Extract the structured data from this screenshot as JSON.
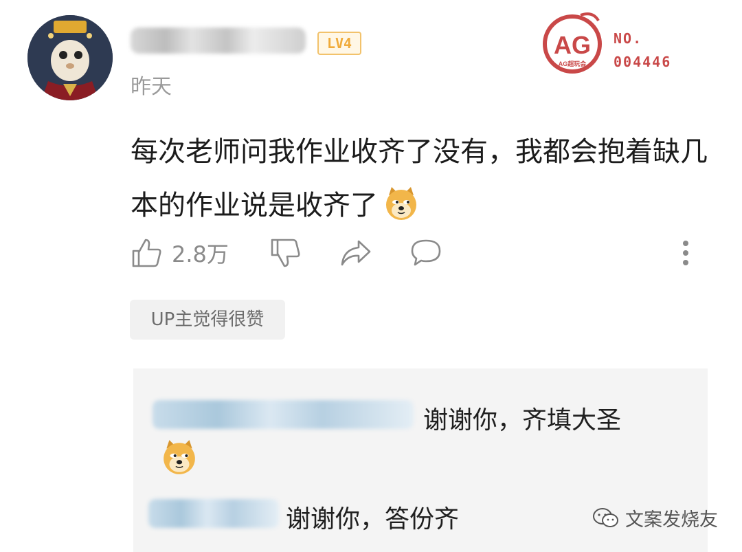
{
  "comment_header": {
    "level_badge": "LV4",
    "timestamp": "昨天"
  },
  "brand": {
    "logo_text": "AG",
    "logo_subtext": "AG超玩会",
    "no_label": "NO.",
    "no_number": "004446"
  },
  "comment": {
    "text": "每次老师问我作业收齐了没有，我都会抱着缺几本的作业说是收齐了"
  },
  "actions": {
    "like_count": "2.8万"
  },
  "up_tag": "UP主觉得很赞",
  "replies": [
    {
      "text": "谢谢你，齐填大圣"
    },
    {
      "text": "谢谢你，答份齐"
    }
  ],
  "watermark": {
    "text": "文案发烧友"
  },
  "colors": {
    "accent_red": "#c94848",
    "level_badge": "#f0ab3a",
    "reply_bg": "#f4f4f4",
    "tag_bg": "#f1f1f1"
  }
}
